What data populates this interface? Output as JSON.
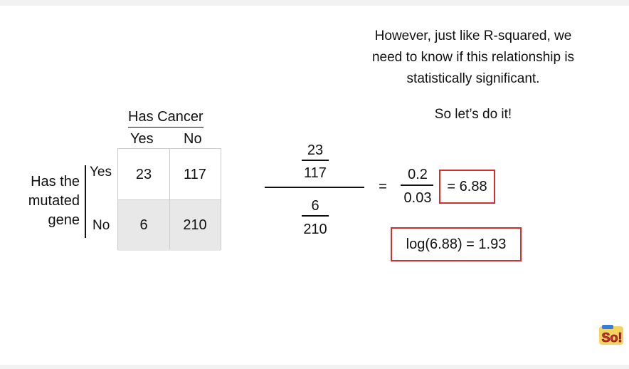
{
  "note": {
    "line1": "However, just like R-squared, we",
    "line2": "need to know if this relationship is",
    "line3": "statistically significant.",
    "line4": "So let’s do it!"
  },
  "table": {
    "col_group_label": "Has Cancer",
    "col_yes": "Yes",
    "col_no": "No",
    "row_group_line1": "Has the",
    "row_group_line2": "mutated",
    "row_group_line3": "gene",
    "row_yes": "Yes",
    "row_no": "No",
    "cells": {
      "yes_yes": "23",
      "yes_no": "117",
      "no_yes": "6",
      "no_no": "210"
    }
  },
  "calc": {
    "top_num": "23",
    "top_den": "117",
    "bot_num": "6",
    "bot_den": "210",
    "equals": "=",
    "res_num": "0.2",
    "res_den": "0.03",
    "odds_ratio": "= 6.88",
    "log_result": "log(6.88) = 1.93"
  },
  "colors": {
    "highlight_box": "#d0312d",
    "shaded_cell": "#e8e8e8"
  },
  "logo": {
    "icon": "statquest-logo-icon",
    "text": "So!"
  }
}
